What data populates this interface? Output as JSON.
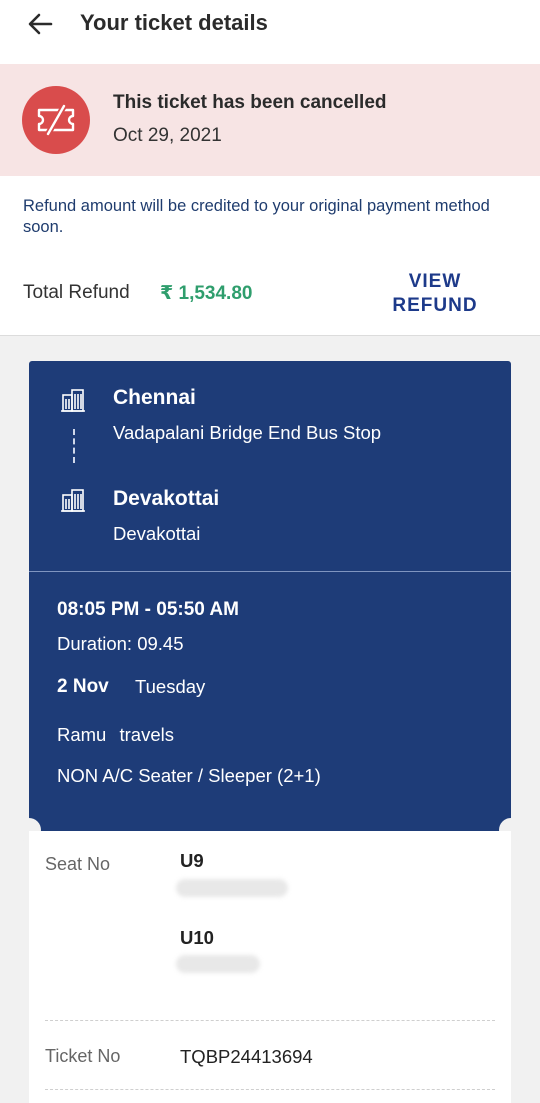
{
  "header": {
    "title": "Your ticket details",
    "back_icon": "arrow-left-icon"
  },
  "cancellation": {
    "icon": "ticket-cancelled-icon",
    "title": "This ticket has been cancelled",
    "date": "Oct 29, 2021",
    "banner_color": "#f7e4e4",
    "icon_color": "#d94c4c"
  },
  "refund": {
    "note": "Refund amount will be credited to your original payment method soon.",
    "total_label": "Total Refund",
    "amount": "₹ 1,534.80",
    "amount_color": "#2f9e6d",
    "view_line1": "VIEW",
    "view_line2": "REFUND"
  },
  "journey": {
    "card_color": "#1e3c78",
    "from_city": "Chennai",
    "from_stop": "Vadapalani Bridge End Bus Stop",
    "to_city": "Devakottai",
    "to_stop": "Devakottai",
    "city_icon": "building-icon",
    "time_range": "08:05 PM - 05:50 AM",
    "duration": "Duration: 09.45",
    "date": "2 Nov",
    "day": "Tuesday",
    "operator": "Ramu travels",
    "bus_type": "NON A/C Seater / Sleeper (2+1)"
  },
  "booking": {
    "seat_label": "Seat No",
    "seats": [
      "U9",
      "U10"
    ],
    "ticket_label": "Ticket No",
    "ticket_no": "TQBP24413694"
  }
}
